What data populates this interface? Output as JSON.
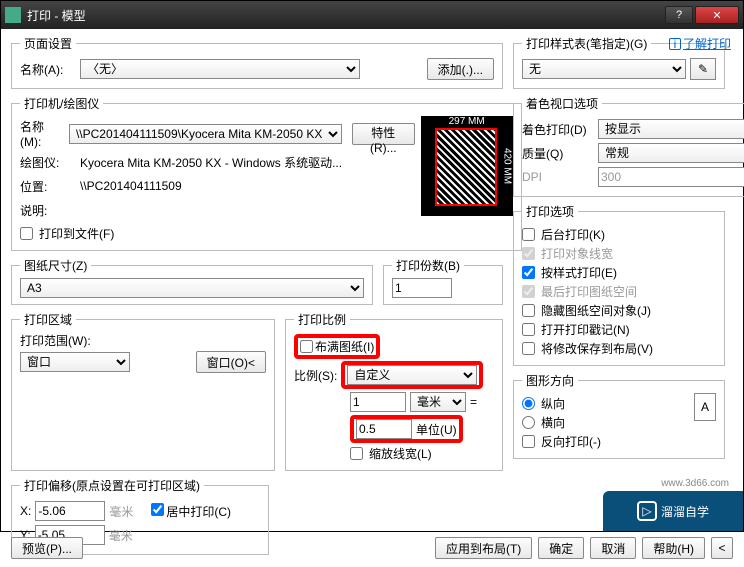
{
  "window": {
    "title": "打印 - 模型",
    "help_link": "了解打印"
  },
  "page_setup": {
    "legend": "页面设置",
    "name_label": "名称(A):",
    "name_value": "〈无〉",
    "add_button": "添加(.)..."
  },
  "printer": {
    "legend": "打印机/绘图仪",
    "name_label": "名称(M):",
    "name_value": "\\\\PC201404111509\\Kyocera Mita KM-2050 KX",
    "props_button": "特性(R)...",
    "plotter_label": "绘图仪:",
    "plotter_value": "Kyocera Mita KM-2050 KX - Windows 系统驱动...",
    "location_label": "位置:",
    "location_value": "\\\\PC201404111509",
    "desc_label": "说明:",
    "desc_value": "",
    "to_file": "打印到文件(F)",
    "preview_top": "297 MM",
    "preview_right": "420 MM"
  },
  "paper": {
    "legend": "图纸尺寸(Z)",
    "value": "A3"
  },
  "copies": {
    "legend": "打印份数(B)",
    "value": "1"
  },
  "area": {
    "legend": "打印区域",
    "range_label": "打印范围(W):",
    "range_value": "窗口",
    "window_btn": "窗口(O)<"
  },
  "scale": {
    "legend": "打印比例",
    "fit_paper": "布满图纸(I)",
    "ratio_label": "比例(S):",
    "ratio_value": "自定义",
    "num1": "1",
    "unit1": "毫米",
    "unit1_suffix": "=",
    "num2": "0.5",
    "unit2": "单位(U)",
    "scale_lw": "缩放线宽(L)"
  },
  "offset": {
    "legend": "打印偏移(原点设置在可打印区域)",
    "x_label": "X:",
    "x_value": "-5.06",
    "x_unit": "毫米",
    "y_label": "Y:",
    "y_value": "-5.05",
    "y_unit": "毫米",
    "center": "居中打印(C)"
  },
  "style": {
    "legend": "打印样式表(笔指定)(G)",
    "value": "无"
  },
  "viewport": {
    "legend": "着色视口选项",
    "shade_label": "着色打印(D)",
    "shade_value": "按显示",
    "quality_label": "质量(Q)",
    "quality_value": "常规",
    "dpi_label": "DPI",
    "dpi_value": "300"
  },
  "options": {
    "legend": "打印选项",
    "items": [
      {
        "label": "后台打印(K)",
        "checked": false,
        "enabled": true
      },
      {
        "label": "打印对象线宽",
        "checked": true,
        "enabled": false
      },
      {
        "label": "按样式打印(E)",
        "checked": true,
        "enabled": true
      },
      {
        "label": "最后打印图纸空间",
        "checked": true,
        "enabled": false
      },
      {
        "label": "隐藏图纸空间对象(J)",
        "checked": false,
        "enabled": true
      },
      {
        "label": "打开打印戳记(N)",
        "checked": false,
        "enabled": true
      },
      {
        "label": "将修改保存到布局(V)",
        "checked": false,
        "enabled": true
      }
    ]
  },
  "orient": {
    "legend": "图形方向",
    "portrait": "纵向",
    "landscape": "横向",
    "upside": "反向打印(-)",
    "icon": "A"
  },
  "footer": {
    "preview": "预览(P)...",
    "apply": "应用到布局(T)",
    "ok": "确定",
    "cancel": "取消",
    "help": "帮助(H)"
  },
  "brand": {
    "text": "溜溜自学",
    "url": "www.3d66.com"
  }
}
